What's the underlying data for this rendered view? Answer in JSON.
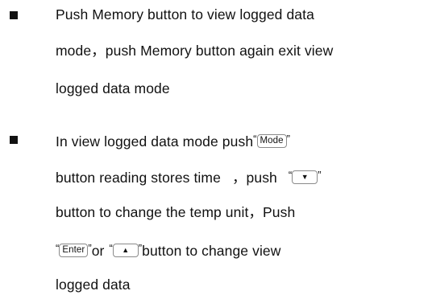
{
  "bullets": [
    {
      "lines": [
        "Push Memory button to view logged data",
        "mode，push Memory button again exit view",
        "logged data mode"
      ]
    },
    {
      "line1_prefix": "In view logged data mode push",
      "mode_key": "Mode",
      "line2_a": "button reading stores time",
      "line2_b": "，push",
      "down_key": "▼",
      "line3": "button to change the temp unit，Push",
      "enter_key": "Enter",
      "line4_or": "or",
      "up_key": "▲",
      "line4_b": "button to change view",
      "line5": "logged data",
      "open_quote": "“",
      "close_quote": "”"
    }
  ]
}
